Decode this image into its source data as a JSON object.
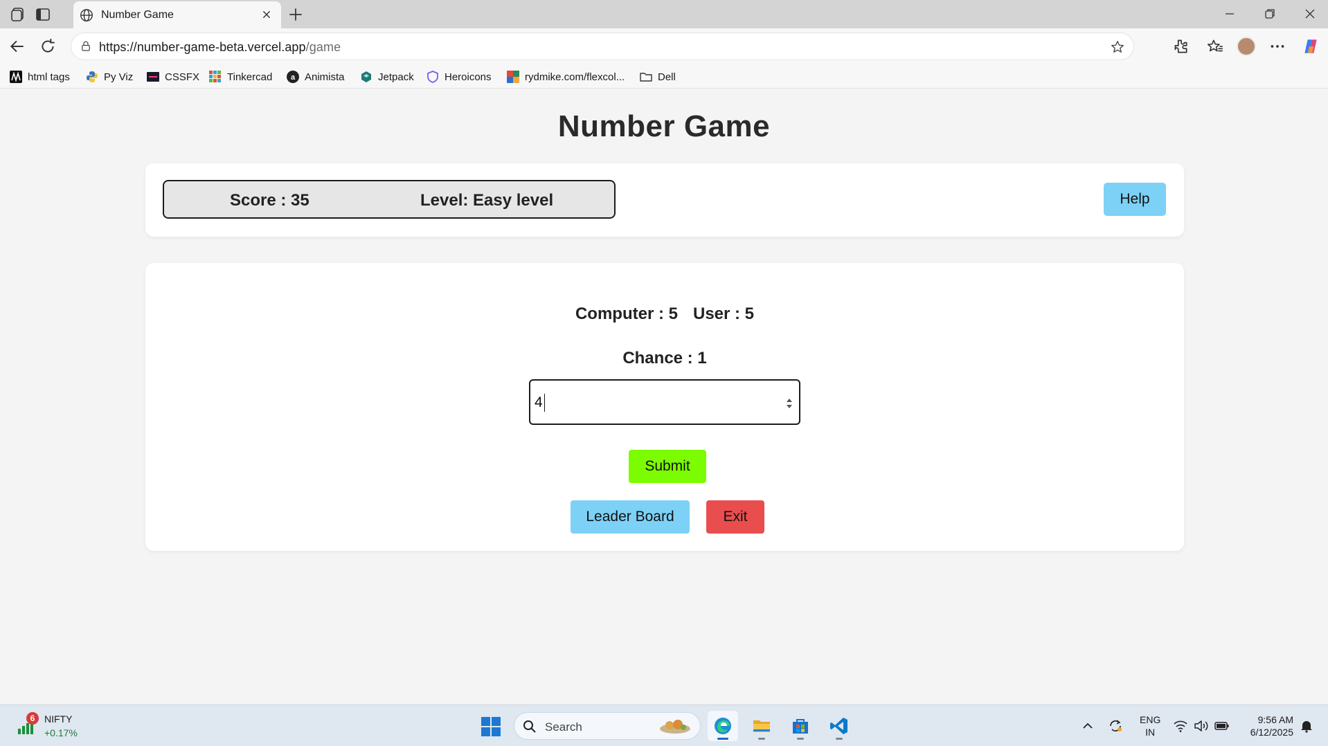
{
  "browser": {
    "tab_title": "Number Game",
    "url_host": "https://number-game-beta.vercel.app",
    "url_path": "/game",
    "bookmarks": [
      {
        "label": "html tags",
        "icon": "w3-icon"
      },
      {
        "label": "Py Viz",
        "icon": "python-icon"
      },
      {
        "label": "CSSFX",
        "icon": "cssfx-icon"
      },
      {
        "label": "Tinkercad",
        "icon": "tinkercad-icon"
      },
      {
        "label": "Animista",
        "icon": "animista-icon"
      },
      {
        "label": "Jetpack",
        "icon": "jetpack-icon"
      },
      {
        "label": "Heroicons",
        "icon": "heroicons-icon"
      },
      {
        "label": "rydmike.com/flexcol...",
        "icon": "flexcolor-icon"
      },
      {
        "label": "Dell",
        "icon": "folder-icon"
      }
    ]
  },
  "game": {
    "title": "Number Game",
    "score_text": "Score : 35",
    "level_text": "Level: Easy level",
    "help_label": "Help",
    "computer_text": "Computer : 5",
    "user_text": "User : 5",
    "chance_text": "Chance : 1",
    "input_value": "4",
    "submit_label": "Submit",
    "leaderboard_label": "Leader Board",
    "exit_label": "Exit"
  },
  "taskbar": {
    "ticker_badge": "6",
    "ticker_name": "NIFTY",
    "ticker_change": "+0.17%",
    "search_label": "Search",
    "lang_line1": "ENG",
    "lang_line2": "IN",
    "time": "9:56 AM",
    "date": "6/12/2025"
  },
  "colors": {
    "help_button": "#7dd1f6",
    "submit_button": "#7cfc00",
    "leaderboard_button": "#7dd1f6",
    "exit_button": "#ea4d4d"
  }
}
